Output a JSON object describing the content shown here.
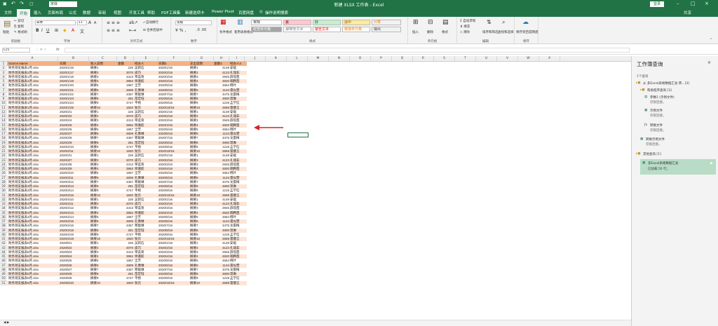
{
  "titlebar": {
    "title": "新建 XLSX 工作表 - Excel",
    "login": "登录",
    "share": "共享"
  },
  "tabs": [
    "文件",
    "开始",
    "插入",
    "页面布局",
    "公式",
    "数据",
    "审阅",
    "视图",
    "开发工具",
    "帮助",
    "PDF工具集",
    "新建选项卡",
    "Power Pivot",
    "百度网盘",
    "操作说明搜索"
  ],
  "ribbon": {
    "clipboard": {
      "paste": "粘贴",
      "cut": "剪切",
      "copy": "复制",
      "painter": "格式刷",
      "label": "剪贴板"
    },
    "font": {
      "name": "宋体",
      "size": "11",
      "label": "字体"
    },
    "align": {
      "wrap": "自动换行",
      "merge": "合并后居中",
      "label": "对齐方式"
    },
    "number": {
      "format": "常规",
      "label": "数字"
    },
    "styles": {
      "cond": "条件格式",
      "table": "套用表格格式",
      "cellstyle": "单元格样式",
      "normal": "常规",
      "bad": "差",
      "good": "好",
      "neutral": "适中",
      "calc": "计算",
      "check": "检查单元格",
      "explain": "解释性文本",
      "warn": "警告文本",
      "link": "链接单元格",
      "output": "输出",
      "label": "样式"
    },
    "cells": {
      "insert": "插入",
      "delete": "删除",
      "format": "格式",
      "label": "单元格"
    },
    "edit": {
      "autosum": "自动求和",
      "fill": "填充",
      "clear": "清除",
      "sort": "排序和筛选",
      "find": "查找和选择",
      "label": "编辑"
    },
    "save": {
      "btn": "保存到百度网盘",
      "label": "保存"
    }
  },
  "formula": {
    "namebox": "L15",
    "fx": "fx"
  },
  "columns": [
    "A",
    "B",
    "C",
    "D",
    "E",
    "F",
    "G",
    "H",
    "I",
    "J",
    "K",
    "L",
    "M",
    "N",
    "O",
    "P",
    "Q",
    "R",
    "S",
    "T",
    "U",
    "V",
    "W",
    "X"
  ],
  "table": {
    "headers": [
      "Source.Name",
      "日期",
      "收入说明",
      "金额",
      "经办人",
      "日期2",
      "支出说明",
      "金额3",
      "经办人4"
    ],
    "rows": [
      [
        "财务领支报表1月.xlsx",
        "2020/1/16",
        "摘要1",
        "226",
        "吴新信",
        "2020/1/16",
        "摘要1",
        "4149",
        "安础"
      ],
      [
        "财务领支报表1月.xlsx",
        "2020/1/17",
        "摘要2",
        "2070",
        "皮巧",
        "2020/2/16",
        "摘要2",
        "4123",
        "孔瑞非"
      ],
      [
        "财务领支报表1月.xlsx",
        "2020/1/18",
        "摘要3",
        "4313",
        "宰奕育",
        "2020/3/16",
        "摘要3",
        "2945",
        "薛现茜"
      ],
      [
        "财务领支报表1月.xlsx",
        "2020/1/19",
        "摘要4",
        "3952",
        "师澈航",
        "2020/4/16",
        "摘要4",
        "4920",
        "喃腾茜"
      ],
      [
        "财务领支报表1月.xlsx",
        "2020/1/20",
        "摘要5",
        "1867",
        "全芳",
        "2020/5/16",
        "摘要5",
        "4554",
        "韩叶"
      ],
      [
        "财务领支报表1月.xlsx",
        "2020/1/21",
        "摘要6",
        "4809",
        "孔像琳",
        "2020/6/16",
        "摘要6",
        "1134",
        "雷似雯"
      ],
      [
        "财务领支报表1月.xlsx",
        "2020/1/22",
        "摘要7",
        "4357",
        "寒耽琳",
        "2020/7/16",
        "摘要7",
        "3475",
        "龙雷梅"
      ],
      [
        "财务领支报表1月.xlsx",
        "2020/1/23",
        "摘要8",
        "281",
        "苗宏钰",
        "2020/8/16",
        "摘要8",
        "4900",
        "琉琳"
      ],
      [
        "财务领支报表1月.xlsx",
        "2020/1/24",
        "摘要9",
        "4747",
        "平杨",
        "2020/9/16",
        "摘要9",
        "1219",
        "孟学信"
      ],
      [
        "财务领支报表1月.xlsx",
        "2020/1/25",
        "摘要10",
        "1820",
        "钛页",
        "2020/10/16",
        "摘要10",
        "2669",
        "雷健言"
      ],
      [
        "财务领支报表2月.xlsx",
        "2020/2/1",
        "摘要1",
        "226",
        "吴新信",
        "2020/1/16",
        "摘要1",
        "4149",
        "安础"
      ],
      [
        "财务领支报表2月.xlsx",
        "2020/2/2",
        "摘要2",
        "2070",
        "皮巧",
        "2020/2/16",
        "摘要2",
        "4123",
        "孔瑞非"
      ],
      [
        "财务领支报表2月.xlsx",
        "2020/2/4",
        "摘要3",
        "4313",
        "宰奕育",
        "2020/3/16",
        "摘要3",
        "2945",
        "薛现茜"
      ],
      [
        "财务领支报表2月.xlsx",
        "2020/2/5",
        "摘要4",
        "3952",
        "师澈航",
        "2020/4/16",
        "摘要4",
        "4920",
        "喃腾茜"
      ],
      [
        "财务领支报表2月.xlsx",
        "2020/2/6",
        "摘要5",
        "1867",
        "全芳",
        "2020/5/16",
        "摘要5",
        "4554",
        "韩叶"
      ],
      [
        "财务领支报表2月.xlsx",
        "2020/2/7",
        "摘要6",
        "4809",
        "孔像琳",
        "2020/6/16",
        "摘要6",
        "1134",
        "雷似雯"
      ],
      [
        "财务领支报表2月.xlsx",
        "2020/2/8",
        "摘要7",
        "4357",
        "寒耽琳",
        "2020/7/16",
        "摘要7",
        "3475",
        "龙雷梅"
      ],
      [
        "财务领支报表2月.xlsx",
        "2020/2/9",
        "摘要8",
        "281",
        "苗宏钰",
        "2020/8/16",
        "摘要8",
        "4900",
        "琉琳"
      ],
      [
        "财务领支报表2月.xlsx",
        "2020/2/10",
        "摘要9",
        "4747",
        "平杨",
        "2020/9/16",
        "摘要9",
        "1219",
        "孟学信"
      ],
      [
        "财务领支报表2月.xlsx",
        "2020/2/11",
        "摘要10",
        "1820",
        "钛页",
        "2020/10/16",
        "摘要10",
        "2669",
        "雷健言"
      ],
      [
        "财务领支报表3月.xlsx",
        "2020/3/1",
        "摘要1",
        "226",
        "吴新信",
        "2020/1/16",
        "摘要1",
        "4149",
        "安础"
      ],
      [
        "财务领支报表3月.xlsx",
        "2020/3/7",
        "摘要2",
        "2070",
        "皮巧",
        "2020/2/16",
        "摘要2",
        "4123",
        "孔瑞非"
      ],
      [
        "财务领支报表3月.xlsx",
        "2020/3/8",
        "摘要3",
        "4313",
        "宰奕育",
        "2020/3/16",
        "摘要3",
        "2945",
        "薛现茜"
      ],
      [
        "财务领支报表3月.xlsx",
        "2020/3/9",
        "摘要4",
        "3952",
        "师澈航",
        "2020/4/16",
        "摘要4",
        "4920",
        "喃腾茜"
      ],
      [
        "财务领支报表3月.xlsx",
        "2020/3/10",
        "摘要5",
        "1867",
        "全芳",
        "2020/5/16",
        "摘要5",
        "4554",
        "韩叶"
      ],
      [
        "财务领支报表3月.xlsx",
        "2020/3/11",
        "摘要6",
        "4809",
        "孔像琳",
        "2020/6/16",
        "摘要6",
        "1134",
        "雷似雯"
      ],
      [
        "财务领支报表3月.xlsx",
        "2020/3/12",
        "摘要7",
        "4357",
        "寒耽琳",
        "2020/7/16",
        "摘要7",
        "3475",
        "龙雷梅"
      ],
      [
        "财务领支报表3月.xlsx",
        "2020/3/13",
        "摘要8",
        "281",
        "苗宏钰",
        "2020/8/16",
        "摘要8",
        "4900",
        "琉琳"
      ],
      [
        "财务领支报表3月.xlsx",
        "2020/3/14",
        "摘要9",
        "4747",
        "平杨",
        "2020/9/16",
        "摘要9",
        "1219",
        "孟学信"
      ],
      [
        "财务领支报表3月.xlsx",
        "2020/3/15",
        "摘要10",
        "1820",
        "钛页",
        "2020/10/16",
        "摘要10",
        "2669",
        "雷健言"
      ],
      [
        "财务领支报表4月.xlsx",
        "2020/4/10",
        "摘要1",
        "226",
        "吴新信",
        "2020/1/16",
        "摘要1",
        "4149",
        "安础"
      ],
      [
        "财务领支报表4月.xlsx",
        "2020/4/11",
        "摘要2",
        "2070",
        "皮巧",
        "2020/2/16",
        "摘要2",
        "4123",
        "孔瑞非"
      ],
      [
        "财务领支报表4月.xlsx",
        "2020/4/12",
        "摘要3",
        "4313",
        "宰奕育",
        "2020/3/16",
        "摘要3",
        "2945",
        "薛现茜"
      ],
      [
        "财务领支报表4月.xlsx",
        "2020/4/13",
        "摘要4",
        "3952",
        "师澈航",
        "2020/4/16",
        "摘要4",
        "4920",
        "喃腾茜"
      ],
      [
        "财务领支报表4月.xlsx",
        "2020/4/14",
        "摘要5",
        "1867",
        "全芳",
        "2020/5/16",
        "摘要5",
        "4554",
        "韩叶"
      ],
      [
        "财务领支报表4月.xlsx",
        "2020/4/15",
        "摘要6",
        "4809",
        "孔像琳",
        "2020/6/16",
        "摘要6",
        "1134",
        "雷似雯"
      ],
      [
        "财务领支报表4月.xlsx",
        "2020/4/16",
        "摘要7",
        "4357",
        "寒耽琳",
        "2020/7/16",
        "摘要7",
        "3475",
        "龙雷梅"
      ],
      [
        "财务领支报表4月.xlsx",
        "2020/4/18",
        "摘要8",
        "281",
        "苗宏钰",
        "2020/8/16",
        "摘要8",
        "4900",
        "琉琳"
      ],
      [
        "财务领支报表4月.xlsx",
        "2020/4/19",
        "摘要9",
        "4747",
        "平杨",
        "2020/9/16",
        "摘要9",
        "1219",
        "孟学信"
      ],
      [
        "财务领支报表4月.xlsx",
        "2020/4/19",
        "摘要10",
        "1820",
        "钛页",
        "2020/10/16",
        "摘要10",
        "2669",
        "雷健言"
      ],
      [
        "财务领支报表5月.xlsx",
        "2020/5/1",
        "摘要1",
        "226",
        "吴新信",
        "2020/1/16",
        "摘要1",
        "4149",
        "安础"
      ],
      [
        "财务领支报表5月.xlsx",
        "2020/5/2",
        "摘要2",
        "2070",
        "皮巧",
        "2020/2/16",
        "摘要2",
        "4123",
        "孔瑞非"
      ],
      [
        "财务领支报表5月.xlsx",
        "2020/5/3",
        "摘要3",
        "4313",
        "宰奕育",
        "2020/3/16",
        "摘要3",
        "2945",
        "薛现茜"
      ],
      [
        "财务领支报表5月.xlsx",
        "2020/5/4",
        "摘要4",
        "3952",
        "师澈航",
        "2020/4/16",
        "摘要4",
        "4920",
        "喃腾茜"
      ],
      [
        "财务领支报表5月.xlsx",
        "2020/5/5",
        "摘要5",
        "1867",
        "全芳",
        "2020/5/16",
        "摘要5",
        "4554",
        "韩叶"
      ],
      [
        "财务领支报表5月.xlsx",
        "2020/5/6",
        "摘要6",
        "4809",
        "孔像琳",
        "2020/6/16",
        "摘要6",
        "1134",
        "雷似雯"
      ],
      [
        "财务领支报表5月.xlsx",
        "2020/5/7",
        "摘要7",
        "4357",
        "寒耽琳",
        "2020/7/16",
        "摘要7",
        "3475",
        "龙雷梅"
      ],
      [
        "财务领支报表5月.xlsx",
        "2020/5/8",
        "摘要8",
        "281",
        "苗宏钰",
        "2020/8/16",
        "摘要8",
        "4900",
        "琉琳"
      ],
      [
        "财务领支报表5月.xlsx",
        "2020/5/9",
        "摘要9",
        "4747",
        "平杨",
        "2020/9/16",
        "摘要9",
        "1219",
        "孟学信"
      ],
      [
        "财务领支报表5月.xlsx",
        "2020/5/10",
        "摘要10",
        "1820",
        "钛页",
        "2020/10/16",
        "摘要10",
        "2669",
        "雷健言"
      ]
    ]
  },
  "pane": {
    "title": "工作簿查询",
    "count": "1个查询",
    "group1": "从 多Excel表格数据汇总 转...[3]",
    "group2": "帮助程序查询 [3]",
    "q_param": "参数1 (示例文件)",
    "q_param_sub": "仅限连接。",
    "q_sample": "示例文件",
    "q_sample_sub": "仅限连接。",
    "q_transform": "转换文件",
    "q_transform_sub": "仅限连接。",
    "q_transform_sample": "转换示例文件",
    "q_transform_sample_sub": "仅限连接。",
    "group3": "其他查询 [1]",
    "q_main": "多Excel表格数据汇总",
    "q_main_sub": "已加载 50 行。"
  },
  "colors": {
    "excel_green": "#217346",
    "header_orange": "#f4b183",
    "band": "#fce4d6",
    "arrow": "#e02020"
  }
}
